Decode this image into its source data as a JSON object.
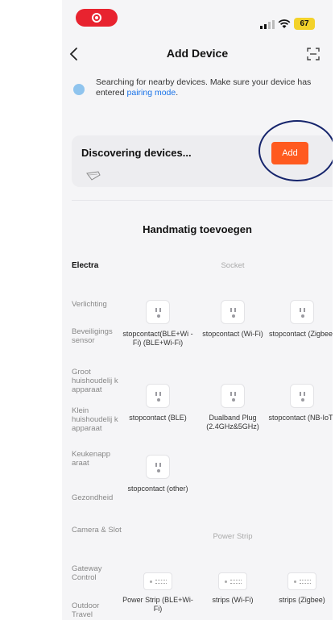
{
  "status_bar": {
    "battery": "67"
  },
  "nav": {
    "title": "Add Device"
  },
  "notice": {
    "text_before": "Searching for nearby devices. Make sure your device has entered ",
    "link": "pairing mode",
    "text_after": "."
  },
  "discover": {
    "title": "Discovering devices...",
    "add_label": "Add"
  },
  "manual": {
    "title": "Handmatig toevoegen",
    "categories": [
      "Electra",
      "Verlichting",
      "Beveiligings sensor",
      "Groot huishoudelij k apparaat",
      "Klein huishoudelij k apparaat",
      "Keukenapp araat",
      "Gezondheid",
      "Camera & Slot",
      "Gateway Control",
      "Outdoor Travel"
    ],
    "groups": {
      "socket": "Socket",
      "power_strip": "Power Strip"
    },
    "devices": [
      "stopcontact(BLE+Wi -Fi) (BLE+Wi-Fi)",
      "stopcontact (Wi-Fi)",
      "stopcontact (Zigbee)",
      "stopcontact (BLE)",
      "Dualband Plug (2.4GHz&5GHz)",
      "stopcontact (NB-IoT)",
      "stopcontact (other)",
      "Power Strip (BLE+Wi-Fi)",
      "strips (Wi-Fi)",
      "strips (Zigbee)"
    ]
  },
  "colors": {
    "accent": "#ff5a1f",
    "link": "#1a73e8",
    "annotation": "#16256c",
    "record": "#e8232f"
  }
}
